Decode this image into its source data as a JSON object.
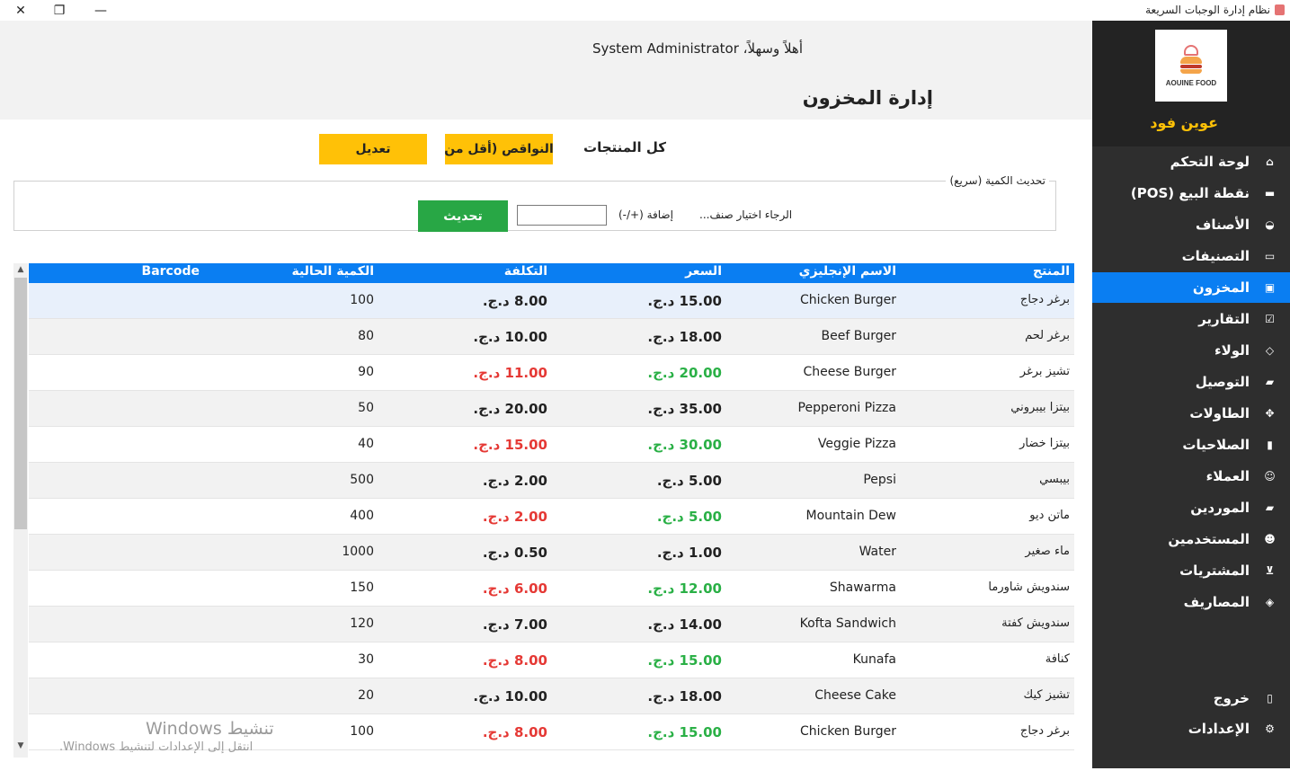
{
  "window": {
    "title": "نظام إدارة الوجبات السريعة",
    "close_glyph": "✕",
    "restore_glyph": "❐",
    "minimize_glyph": "—"
  },
  "header": {
    "welcome": "أهلاً وسهلاً، System Administrator",
    "page_title": "إدارة المخزون"
  },
  "filters": {
    "all_products": "كل المنتجات",
    "shortages": "النواقص (أقل من",
    "edit": "تعديل"
  },
  "quick_update": {
    "legend": "تحديث الكمية (سريع)",
    "choose_item": "الرجاء اختيار صنف...",
    "add_label": "إضافة (+/-)",
    "input_value": "",
    "update_button": "تحديث"
  },
  "table": {
    "columns": [
      "المنتج",
      "الاسم الإنجليزي",
      "السعر",
      "التكلفة",
      "الكمية الحالية",
      "Barcode"
    ],
    "rows": [
      {
        "name": "برغر دجاج",
        "en": "Chicken Burger",
        "price": "15.00 د.ج.",
        "cost": "8.00 د.ج.",
        "qty": "100",
        "price_color": "normal",
        "cost_color": "normal",
        "selected": true
      },
      {
        "name": "برغر لحم",
        "en": "Beef Burger",
        "price": "18.00 د.ج.",
        "cost": "10.00 د.ج.",
        "qty": "80",
        "price_color": "normal",
        "cost_color": "normal"
      },
      {
        "name": "تشيز برغر",
        "en": "Cheese Burger",
        "price": "20.00 د.ج.",
        "cost": "11.00 د.ج.",
        "qty": "90",
        "price_color": "green",
        "cost_color": "red"
      },
      {
        "name": "بيتزا بيبروني",
        "en": "Pepperoni Pizza",
        "price": "35.00 د.ج.",
        "cost": "20.00 د.ج.",
        "qty": "50",
        "price_color": "normal",
        "cost_color": "normal"
      },
      {
        "name": "بيتزا خضار",
        "en": "Veggie Pizza",
        "price": "30.00 د.ج.",
        "cost": "15.00 د.ج.",
        "qty": "40",
        "price_color": "green",
        "cost_color": "red"
      },
      {
        "name": "بيبسي",
        "en": "Pepsi",
        "price": "5.00 د.ج.",
        "cost": "2.00 د.ج.",
        "qty": "500",
        "price_color": "normal",
        "cost_color": "normal"
      },
      {
        "name": "ماتن ديو",
        "en": "Mountain Dew",
        "price": "5.00 د.ج.",
        "cost": "2.00 د.ج.",
        "qty": "400",
        "price_color": "green",
        "cost_color": "red"
      },
      {
        "name": "ماء صغير",
        "en": "Water",
        "price": "1.00 د.ج.",
        "cost": "0.50 د.ج.",
        "qty": "1000",
        "price_color": "normal",
        "cost_color": "normal"
      },
      {
        "name": "سندويش شاورما",
        "en": "Shawarma",
        "price": "12.00 د.ج.",
        "cost": "6.00 د.ج.",
        "qty": "150",
        "price_color": "green",
        "cost_color": "red"
      },
      {
        "name": "سندويش كفتة",
        "en": "Kofta Sandwich",
        "price": "14.00 د.ج.",
        "cost": "7.00 د.ج.",
        "qty": "120",
        "price_color": "normal",
        "cost_color": "normal"
      },
      {
        "name": "كنافة",
        "en": "Kunafa",
        "price": "15.00 د.ج.",
        "cost": "8.00 د.ج.",
        "qty": "30",
        "price_color": "green",
        "cost_color": "red"
      },
      {
        "name": "تشيز كيك",
        "en": "Cheese Cake",
        "price": "18.00 د.ج.",
        "cost": "10.00 د.ج.",
        "qty": "20",
        "price_color": "normal",
        "cost_color": "normal"
      },
      {
        "name": "برغر دجاج",
        "en": "Chicken Burger",
        "price": "15.00 د.ج.",
        "cost": "8.00 د.ج.",
        "qty": "100",
        "price_color": "green",
        "cost_color": "red"
      }
    ]
  },
  "watermark": {
    "line1": "تنشيط Windows",
    "line2": "انتقل إلى الإعدادات لتنشيط Windows."
  },
  "sidebar": {
    "logo_text": "AOUINE FOOD",
    "brand": "عوين فود",
    "items": [
      {
        "label": "لوحة التحكم",
        "icon": "dashboard-icon",
        "glyph": "⌂"
      },
      {
        "label": "نقطة البيع (POS)",
        "icon": "pos-icon",
        "glyph": "▬"
      },
      {
        "label": "الأصناف",
        "icon": "items-icon",
        "glyph": "◒"
      },
      {
        "label": "التصنيفات",
        "icon": "folder-icon",
        "glyph": "▭"
      },
      {
        "label": "المخزون",
        "icon": "inventory-icon",
        "glyph": "▣"
      },
      {
        "label": "التقارير",
        "icon": "reports-icon",
        "glyph": "☑"
      },
      {
        "label": "الولاء",
        "icon": "diamond-icon",
        "glyph": "◇"
      },
      {
        "label": "التوصيل",
        "icon": "truck-icon",
        "glyph": "▰"
      },
      {
        "label": "الطاولات",
        "icon": "table-icon",
        "glyph": "✥"
      },
      {
        "label": "الصلاحيات",
        "icon": "lock-icon",
        "glyph": "▮"
      },
      {
        "label": "العملاء",
        "icon": "user-icon",
        "glyph": "☺"
      },
      {
        "label": "الموردين",
        "icon": "truck-icon",
        "glyph": "▰"
      },
      {
        "label": "المستخدمين",
        "icon": "users-icon",
        "glyph": "☻"
      },
      {
        "label": "المشتريات",
        "icon": "cart-icon",
        "glyph": "⊻"
      },
      {
        "label": "المصاريف",
        "icon": "money-icon",
        "glyph": "◈"
      }
    ],
    "logout": {
      "label": "خروج",
      "icon": "logout-icon",
      "glyph": "▯"
    },
    "settings": {
      "label": "الإعدادات",
      "icon": "gear-icon",
      "glyph": "⚙"
    }
  }
}
